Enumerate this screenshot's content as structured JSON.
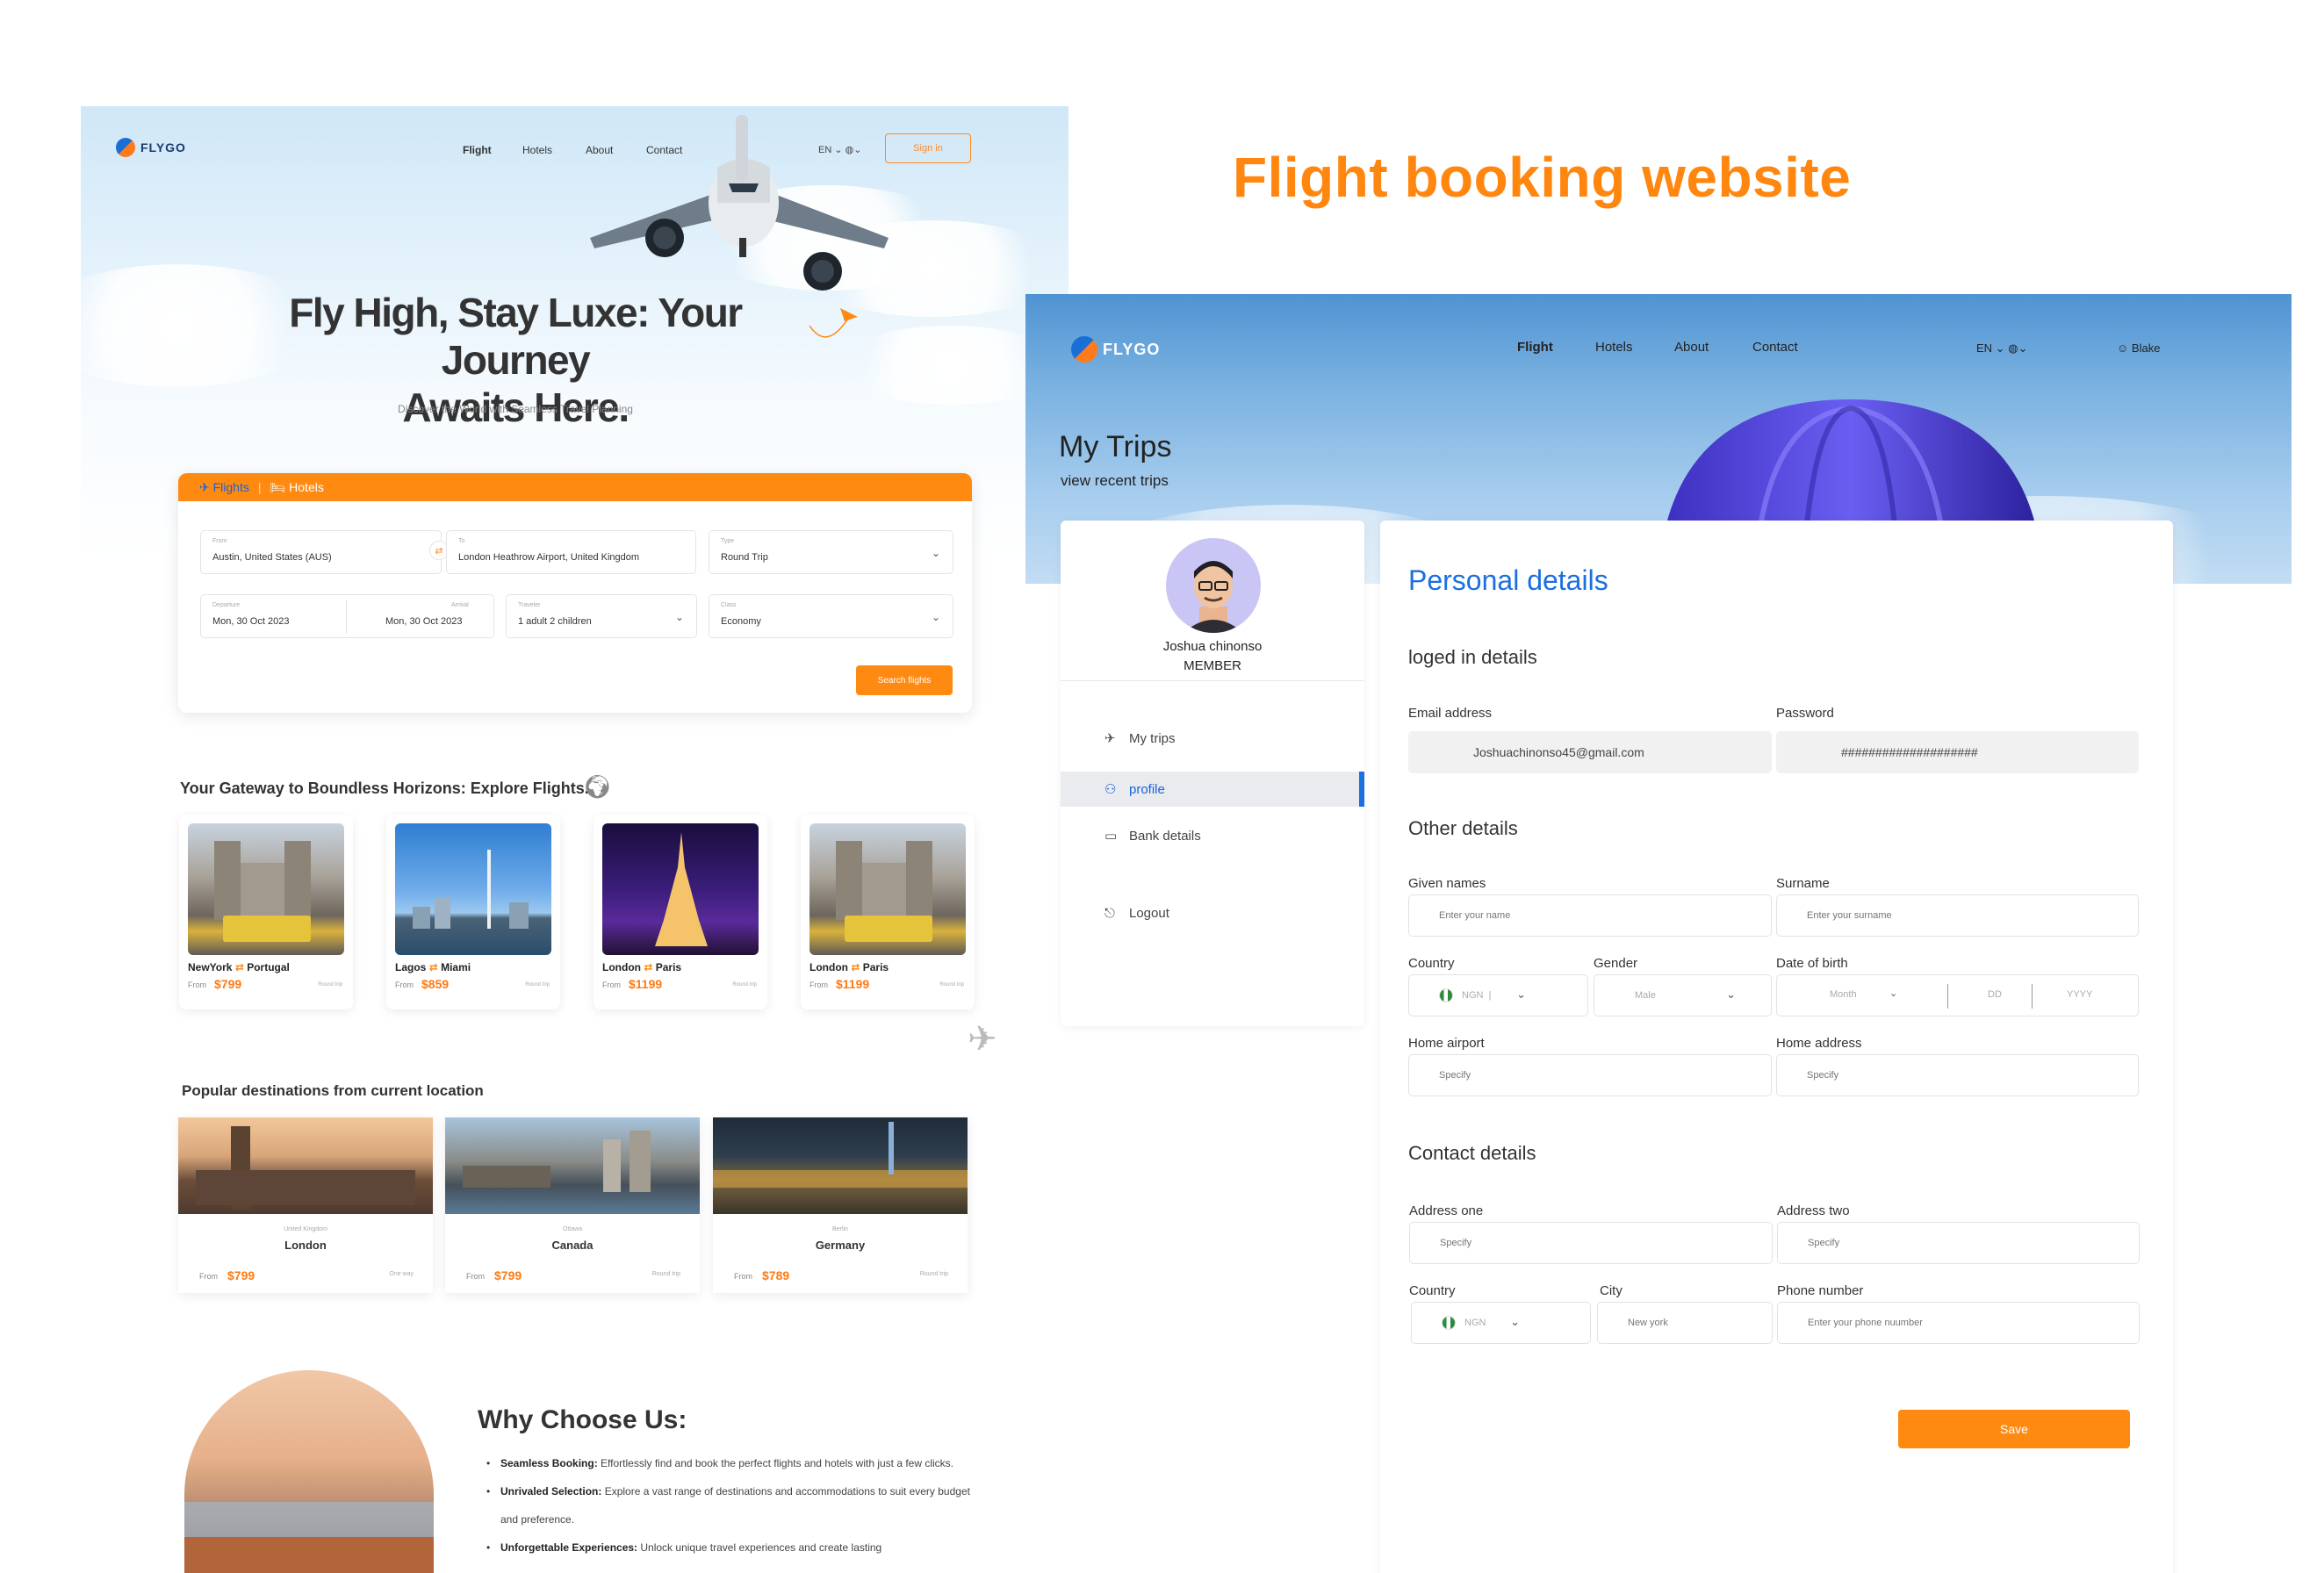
{
  "page": {
    "heading": "Flight booking website"
  },
  "landing": {
    "logo": "FLYGO",
    "nav": [
      "Flight",
      "Hotels",
      "About",
      "Contact"
    ],
    "lang": "EN",
    "sign_in": "Sign in",
    "hero_title_1": "Fly High, Stay Luxe: Your Journey",
    "hero_title_2": "Awaits Here.",
    "hero_sub": "Discover the World with Seamless Travel Planning",
    "tabs": {
      "flights": "✈ Flights",
      "hotels": "🛏 Hotels"
    },
    "search": {
      "from_label": "From",
      "from_value": "Austin, United States (AUS)",
      "to_label": "To",
      "to_value": "London Heathrow Airport, United Kingdom",
      "type_label": "Type",
      "type_value": "Round Trip",
      "departure_label": "Departure",
      "departure_value": "Mon, 30 Oct 2023",
      "arrival_label": "Arrival",
      "arrival_value": "Mon, 30 Oct 2023",
      "traveler_label": "Traveler",
      "traveler_value": "1 adult 2 children",
      "class_label": "Class",
      "class_value": "Economy",
      "button": "Search flights"
    },
    "gateway_title": "Your Gateway to Boundless Horizons: Explore Flights.",
    "flights": [
      {
        "from": "NewYork",
        "to": "Portugal",
        "from_label": "From",
        "price": "$799",
        "trip": "Round trip"
      },
      {
        "from": "Lagos",
        "to": "Miami",
        "from_label": "From",
        "price": "$859",
        "trip": "Round trip"
      },
      {
        "from": "London",
        "to": "Paris",
        "from_label": "From",
        "price": "$1199",
        "trip": "Round trip"
      },
      {
        "from": "London",
        "to": "Paris",
        "from_label": "From",
        "price": "$1199",
        "trip": "Round trip"
      }
    ],
    "popular_title": "Popular destinations from current location",
    "popular": [
      {
        "country": "United Kingdom",
        "city": "London",
        "from_label": "From",
        "price": "$799",
        "trip": "One way"
      },
      {
        "country": "Ottawa",
        "city": "Canada",
        "from_label": "From",
        "price": "$799",
        "trip": "Round trip"
      },
      {
        "country": "Berlin",
        "city": "Germany",
        "from_label": "From",
        "price": "$789",
        "trip": "Round trip"
      }
    ],
    "why_title": "Why Choose Us:",
    "why": [
      {
        "bold": "Seamless Booking:",
        "text": " Effortlessly find and book the perfect flights and hotels with just a few clicks."
      },
      {
        "bold": "Unrivaled Selection:",
        "text": " Explore a vast range of destinations and accommodations to suit every budget and preference."
      },
      {
        "bold": "Unforgettable Experiences:",
        "text": " Unlock unique travel experiences and create lasting"
      }
    ]
  },
  "app": {
    "logo": "FLYGO",
    "nav": [
      "Flight",
      "Hotels",
      "About",
      "Contact"
    ],
    "lang": "EN",
    "user": "Blake",
    "title": "My Trips",
    "subtitle": "view recent trips",
    "profile": {
      "name": "Joshua chinonso",
      "role": "MEMBER"
    },
    "menu": [
      "My trips",
      "profile",
      "Bank details",
      "Logout"
    ],
    "personal_title": "Personal details",
    "logged_title": "loged in details",
    "email_label": "Email address",
    "email_value": "Joshuachinonso45@gmail.com",
    "password_label": "Password",
    "password_value": "####################",
    "other_title": "Other details",
    "given_label": "Given names",
    "given_placeholder": "Enter your name",
    "surname_label": "Surname",
    "surname_placeholder": "Enter your surname",
    "country_label": "Country",
    "country_value": "NGN",
    "gender_label": "Gender",
    "gender_value": "Male",
    "dob_label": "Date of birth",
    "dob_month": "Month",
    "dob_day": "DD",
    "dob_year": "YYYY",
    "home_airport_label": "Home airport",
    "home_airport_placeholder": "Specify",
    "home_address_label": "Home address",
    "home_address_placeholder": "Specify",
    "contact_title": "Contact details",
    "addr1_label": "Address one",
    "addr1_placeholder": "Specify",
    "addr2_label": "Address two",
    "addr2_placeholder": "Specify",
    "country2_label": "Country",
    "country2_value": "NGN",
    "city_label": "City",
    "city_placeholder": "New york",
    "phone_label": "Phone number",
    "phone_placeholder": "Enter your phone nuumber",
    "save": "Save"
  },
  "colors": {
    "accent": "#ff8a12",
    "primary": "#1b6fe0"
  }
}
